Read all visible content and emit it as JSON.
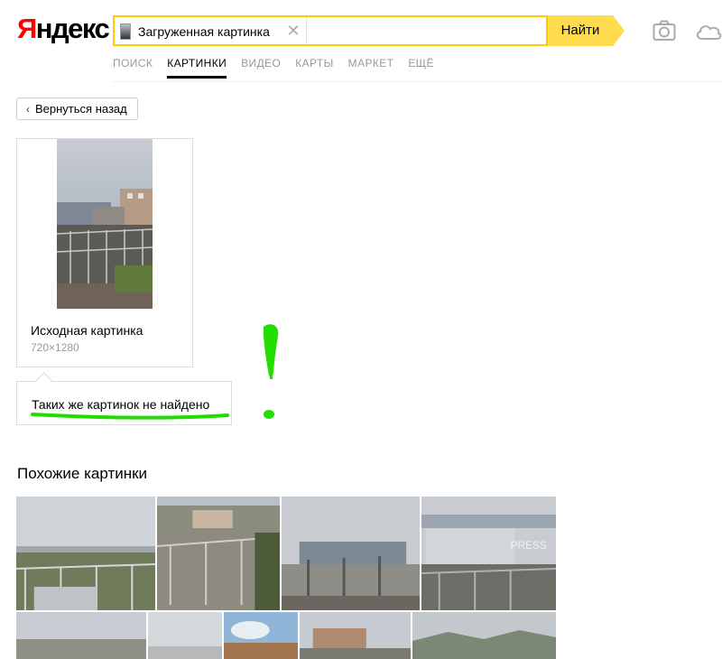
{
  "logo": {
    "first_letter": "Я",
    "rest": "ндекс"
  },
  "search": {
    "chip_label": "Загруженная картинка",
    "button_label": "Найти"
  },
  "tabs": [
    {
      "label": "Поиск",
      "active": false
    },
    {
      "label": "Картинки",
      "active": true
    },
    {
      "label": "Видео",
      "active": false
    },
    {
      "label": "Карты",
      "active": false
    },
    {
      "label": "Маркет",
      "active": false
    },
    {
      "label": "Ещё",
      "active": false
    }
  ],
  "back_button": {
    "label": "Вернуться назад"
  },
  "original": {
    "title": "Исходная картинка",
    "size": "720×1280"
  },
  "not_found": {
    "text": "Таких же картинок не найдено"
  },
  "similar": {
    "title": "Похожие картинки",
    "watermark": "PRESS"
  },
  "colors": {
    "accent": "#ffdb4d",
    "logo_red": "#ff0000",
    "annotation_green": "#22dd00"
  }
}
